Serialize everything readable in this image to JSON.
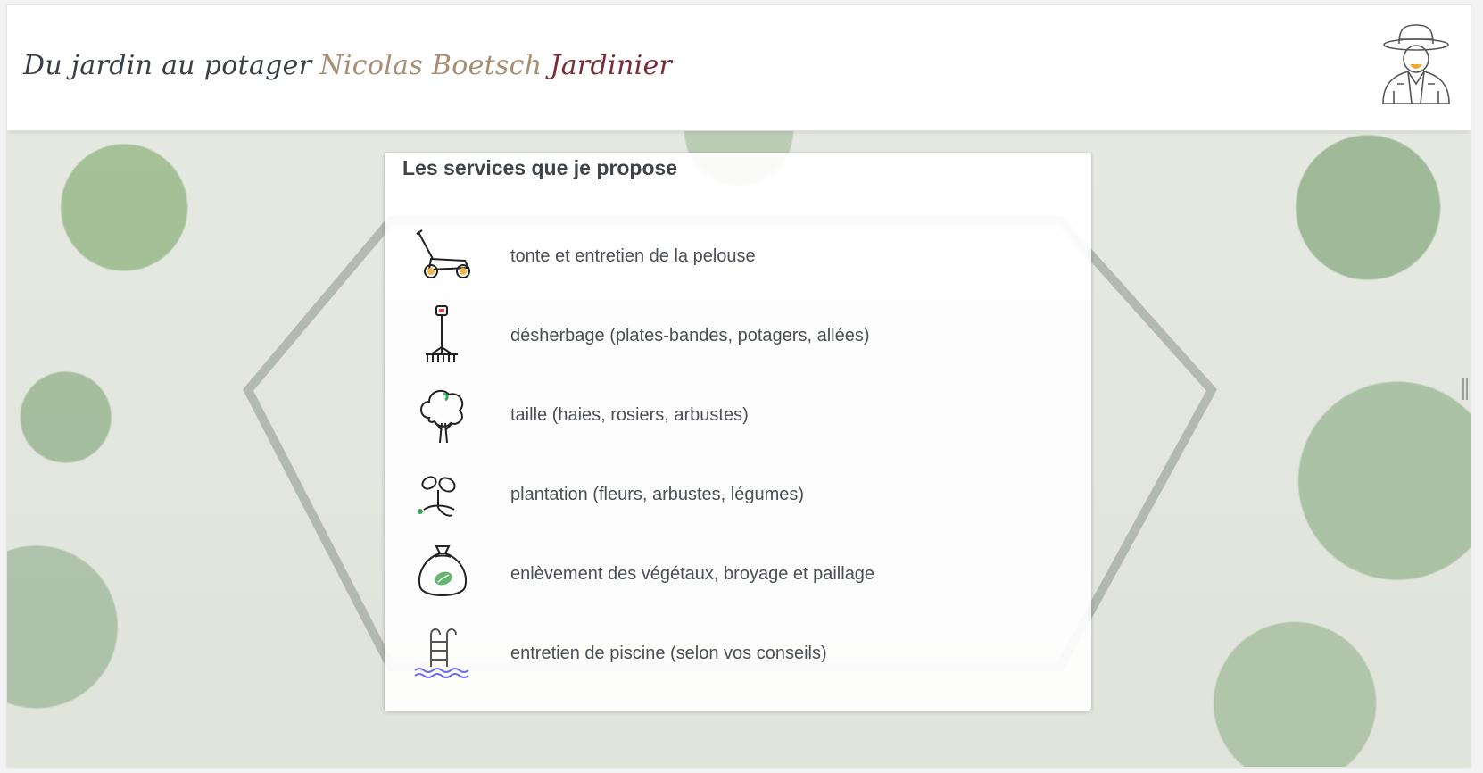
{
  "header": {
    "title_part1": "Du jardin au potager",
    "title_part2": "Nicolas Boetsch",
    "title_part3": "Jardinier",
    "avatar_icon": "gardener-hat-avatar-icon"
  },
  "services": {
    "title": "Les services que je propose",
    "items": [
      {
        "icon": "lawnmower-icon",
        "label": "tonte et entretien de la pelouse"
      },
      {
        "icon": "rake-icon",
        "label": "désherbage (plates-bandes, potagers, allées)"
      },
      {
        "icon": "tree-icon",
        "label": "taille (haies, rosiers, arbustes)"
      },
      {
        "icon": "seedling-icon",
        "label": "plantation (fleurs, arbustes, légumes)"
      },
      {
        "icon": "green-waste-bag-icon",
        "label": "enlèvement des végétaux, broyage et paillage"
      },
      {
        "icon": "pool-ladder-icon",
        "label": "entretien de piscine (selon vos conseils)"
      }
    ]
  },
  "colors": {
    "title_dark": "#3a4048",
    "title_tan": "#a88f73",
    "title_wine": "#7a2d36",
    "text": "#4a4e55"
  }
}
